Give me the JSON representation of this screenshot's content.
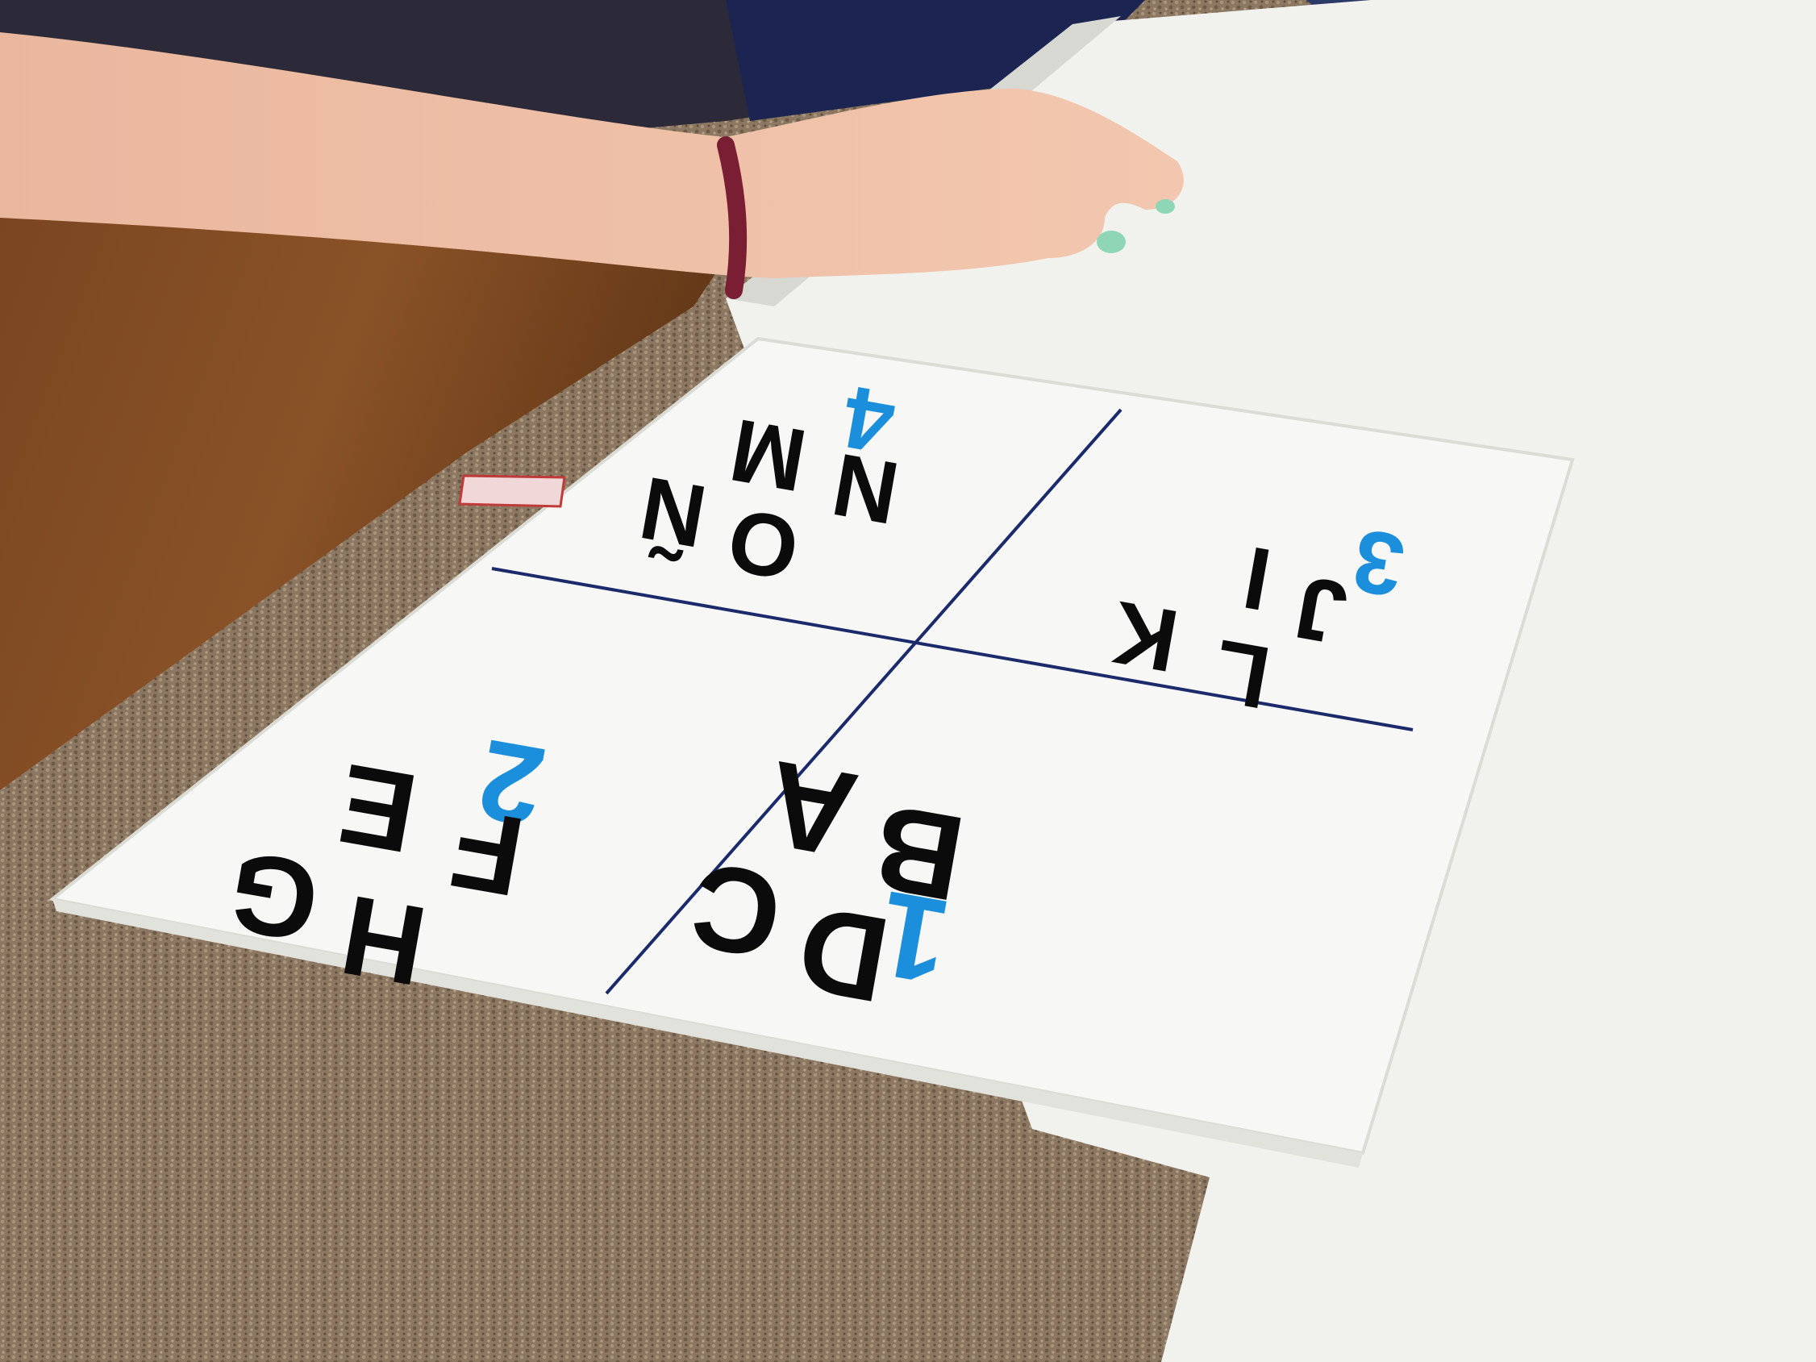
{
  "board": {
    "quadrants": [
      {
        "number": "1",
        "letters": [
          "A",
          "B",
          "C",
          "D"
        ]
      },
      {
        "number": "2",
        "letters": [
          "E",
          "F",
          "G",
          "H"
        ]
      },
      {
        "number": "3",
        "letters": [
          "I",
          "J",
          "K",
          "L"
        ]
      },
      {
        "number": "4",
        "letters": [
          "M",
          "N",
          "Ñ",
          "O"
        ]
      }
    ]
  },
  "colors": {
    "number": "#1b8fdc",
    "letters": "#0b0b0b",
    "grid_lines": "#1a2a6b",
    "board": "#f7f7f5",
    "table_top": "#f2f2ef",
    "carpet": "#8a7660",
    "wood_floor": "#6e3f1c"
  }
}
